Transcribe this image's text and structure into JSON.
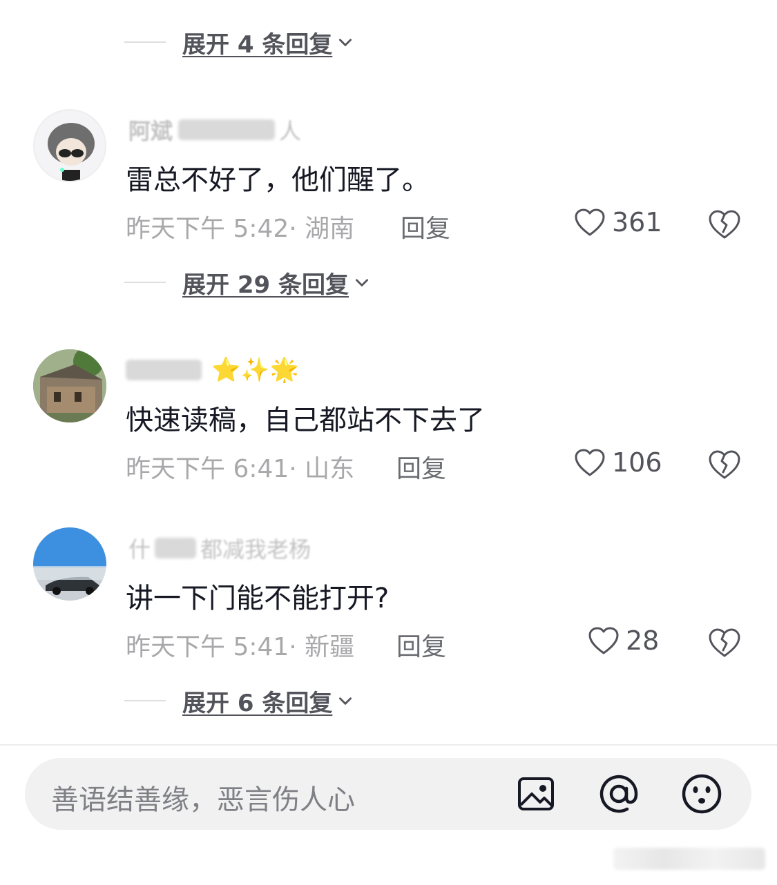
{
  "expand_replies": [
    {
      "label": "展开 4 条回复"
    },
    {
      "label": "展开 29 条回复"
    },
    {
      "label": "展开 6 条回复"
    }
  ],
  "comments": [
    {
      "username": "阿斌",
      "username_suffix": "人",
      "text": "雷总不好了，他们醒了。",
      "time_location": "昨天下午 5:42· 湖南",
      "reply_label": "回复",
      "likes": "361"
    },
    {
      "username": "",
      "username_suffix": "⭐✨🌟",
      "text": "快速读稿，自己都站不下去了",
      "time_location": "昨天下午 6:41· 山东",
      "reply_label": "回复",
      "likes": "106"
    },
    {
      "username": "什",
      "username_suffix": "都减我老杨",
      "text": "讲一下门能不能打开?",
      "time_location": "昨天下午 5:41· 新疆",
      "reply_label": "回复",
      "likes": "28"
    }
  ],
  "input": {
    "placeholder": "善语结善缘，恶言伤人心"
  },
  "icons": {
    "image": "image-icon",
    "mention": "at-icon",
    "emoji": "emoji-icon",
    "like": "heart-icon",
    "dislike": "broken-heart-icon"
  },
  "colors": {
    "text_primary": "#161823",
    "text_secondary": "#a8a8ab",
    "input_bg": "#f1f1f2"
  }
}
